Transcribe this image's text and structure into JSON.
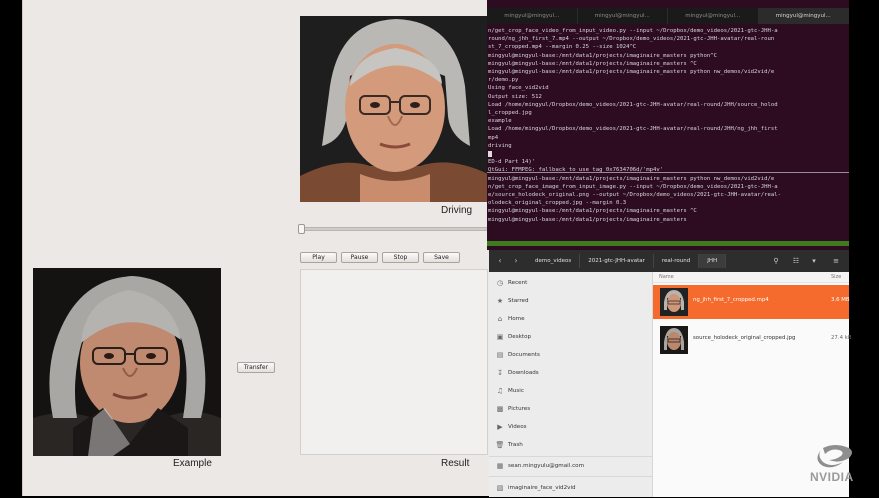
{
  "left_app": {
    "driving_caption": "Driving",
    "example_caption": "Example",
    "result_caption": "Result",
    "controls": {
      "play": "Play",
      "pause": "Pause",
      "stop": "Stop",
      "save": "Save"
    },
    "transfer_label": "Transfer",
    "seek_progress": 0.0
  },
  "terminal": {
    "tabs": [
      "mingyul@mingyul...",
      "mingyul@mingyul...",
      "mingyul@mingyul...",
      "mingyul@mingyul..."
    ],
    "lines": [
      "n/get_crop_face_video_from_input_video.py --input ~/Dropbox/demo_videos/2021-gtc-JHH-a",
      "round/ng_jhh_first_7.mp4 --output ~/Dropbox/demo_videos/2021-gtc-JHH-avatar/real-roun",
      "st_7_cropped.mp4 --margin 0.25 --size 1024^C",
      "mingyul@mingyul-base:/mnt/data1/projects/imaginaire_masters python^C",
      "mingyul@mingyul-base:/mnt/data1/projects/imaginaire_masters ^C",
      "mingyul@mingyul-base:/mnt/data1/projects/imaginaire_masters python nw_demos/vid2vid/e",
      "r/demo.py",
      "Using face_vid2vid",
      "Output size: 512",
      "Load /home/mingyul/Dropbox/demo_videos/2021-gtc-JHH-avatar/real-round/JHH/source_holod",
      "l_cropped.jpg",
      "example",
      "Load /home/mingyul/Dropbox/demo_videos/2021-gtc-JHH-avatar/real-round/JHH/ng_jhh_first",
      "mp4",
      "driving",
      "",
      "",
      "ED-d Part 14)'",
      "QtGui: FFMPEG: fallback to use tag 0x7634706d/'mp4v'",
      "mingyul@mingyul-base:/mnt/data1/projects/imaginaire_masters python nw_demos/vid2vid/e",
      "n/get_crop_face_image_from_input_image.py --input ~/Dropbox/demo_videos/2021-gtc-JHH-a",
      "e/source_holodeck_original.png --output ~/Dropbox/demo_videos/2021-gtc-JHH-avatar/real-",
      "olodeck_original_cropped.jpg --margin 0.3",
      "mingyul@mingyul-base:/mnt/data1/projects/imaginaire_masters ^C",
      "mingyul@mingyul-base:/mnt/data1/projects/imaginaire_masters"
    ]
  },
  "files": {
    "breadcrumbs": [
      "demo_videos",
      "2021-gtc-JHH-avatar",
      "real-round",
      "JHH"
    ],
    "columns": {
      "name": "Name",
      "size": "Size"
    },
    "sidebar": [
      {
        "label": "Recent",
        "icon": "clock-icon"
      },
      {
        "label": "Starred",
        "icon": "star-icon"
      },
      {
        "label": "Home",
        "icon": "home-icon"
      },
      {
        "label": "Desktop",
        "icon": "desktop-icon"
      },
      {
        "label": "Documents",
        "icon": "documents-icon"
      },
      {
        "label": "Downloads",
        "icon": "downloads-icon"
      },
      {
        "label": "Music",
        "icon": "music-icon"
      },
      {
        "label": "Pictures",
        "icon": "pictures-icon"
      },
      {
        "label": "Videos",
        "icon": "videos-icon"
      },
      {
        "label": "Trash",
        "icon": "trash-icon"
      },
      {
        "label": "sean.mingyulu@gmail.com",
        "icon": "account-icon"
      },
      {
        "label": "imaginaire_face_vid2vid",
        "icon": "drive-icon"
      }
    ],
    "rows": [
      {
        "name": "ng_jhh_first_7_cropped.mp4",
        "size": "3.6 MB",
        "selected": true
      },
      {
        "name": "source_holodeck_original_cropped.jpg",
        "size": "27.4 kB",
        "selected": false
      }
    ]
  },
  "watermark": "NVIDIA"
}
